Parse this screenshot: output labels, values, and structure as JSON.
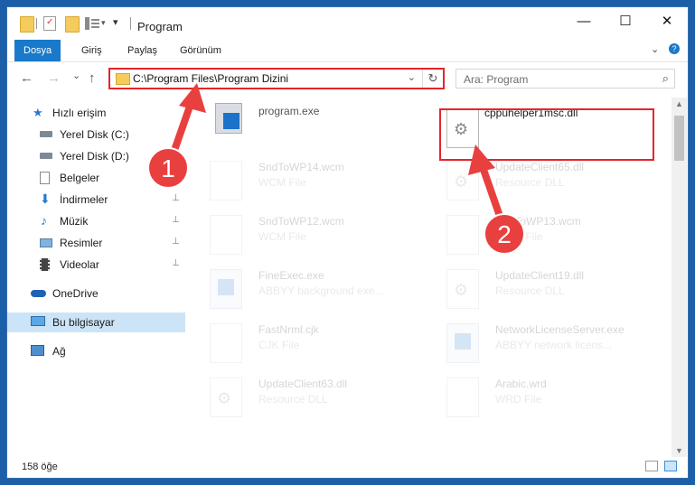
{
  "window": {
    "title": "Program",
    "minimize_glyph": "—",
    "maximize_glyph": "☐",
    "close_glyph": "✕"
  },
  "ribbon": {
    "tabs": [
      {
        "label": "Dosya",
        "active": true
      },
      {
        "label": "Giriş",
        "active": false
      },
      {
        "label": "Paylaş",
        "active": false
      },
      {
        "label": "Görünüm",
        "active": false
      }
    ],
    "expand_glyph": "⌄",
    "help_glyph": "?"
  },
  "navigation": {
    "back_glyph": "←",
    "forward_glyph": "→",
    "recent_glyph": "⌄",
    "up_glyph": "↑",
    "address_path": "C:\\Program Files\\Program Dizini",
    "address_dropdown_glyph": "⌄",
    "refresh_glyph": "↻",
    "search_placeholder": "Ara: Program",
    "search_glyph": "⌕"
  },
  "sidebar": {
    "items": [
      {
        "label": "Hızlı erişim",
        "icon": "star-icon",
        "pinned": false
      },
      {
        "label": "Yerel Disk (C:)",
        "icon": "drive-icon",
        "pinned": false
      },
      {
        "label": "Yerel Disk (D:)",
        "icon": "drive-icon",
        "pinned": false
      },
      {
        "label": "Belgeler",
        "icon": "documents-icon",
        "pinned": true
      },
      {
        "label": "İndirmeler",
        "icon": "download-icon",
        "pinned": true
      },
      {
        "label": "Müzik",
        "icon": "music-icon",
        "pinned": true
      },
      {
        "label": "Resimler",
        "icon": "pictures-icon",
        "pinned": true
      },
      {
        "label": "Videolar",
        "icon": "videos-icon",
        "pinned": true
      },
      {
        "label": "OneDrive",
        "icon": "cloud-icon",
        "pinned": false
      },
      {
        "label": "Bu bilgisayar",
        "icon": "computer-icon",
        "pinned": false,
        "selected": true
      },
      {
        "label": "Ağ",
        "icon": "network-icon",
        "pinned": false
      }
    ],
    "pin_glyph": "📌"
  },
  "files": [
    {
      "name": "program.exe",
      "type": "",
      "icon": "exe-icon",
      "faded": false
    },
    {
      "name": "cppuhelper1msc.dll",
      "type": "",
      "icon": "dll-gear-icon",
      "faded": false,
      "highlighted": true
    },
    {
      "name": "SndToWP14.wcm",
      "type": "WCM File",
      "icon": "file-icon",
      "faded": true
    },
    {
      "name": "UpdateClient65.dll",
      "type": "Resource DLL",
      "icon": "dll-gear-icon",
      "faded": true
    },
    {
      "name": "SndToWP12.wcm",
      "type": "WCM File",
      "icon": "file-icon",
      "faded": true
    },
    {
      "name": "SndToWP13.wcm",
      "type": "WCM File",
      "icon": "file-icon",
      "faded": true
    },
    {
      "name": "FineExec.exe",
      "type": "ABBYY background exe...",
      "icon": "exe-icon",
      "faded": true
    },
    {
      "name": "UpdateClient19.dll",
      "type": "Resource DLL",
      "icon": "dll-gear-icon",
      "faded": true
    },
    {
      "name": "FastNrml.cjk",
      "type": "CJK File",
      "icon": "file-icon",
      "faded": true
    },
    {
      "name": "NetworkLicenseServer.exe",
      "type": "ABBYY network licens...",
      "icon": "exe-icon",
      "faded": true
    },
    {
      "name": "UpdateClient63.dll",
      "type": "Resource DLL",
      "icon": "dll-gear-icon",
      "faded": true
    },
    {
      "name": "Arabic.wrd",
      "type": "WRD File",
      "icon": "file-icon",
      "faded": true
    }
  ],
  "annotations": {
    "step1": "1",
    "step2": "2",
    "color": "#e8403f"
  },
  "status": {
    "item_count": "158 öğe"
  }
}
